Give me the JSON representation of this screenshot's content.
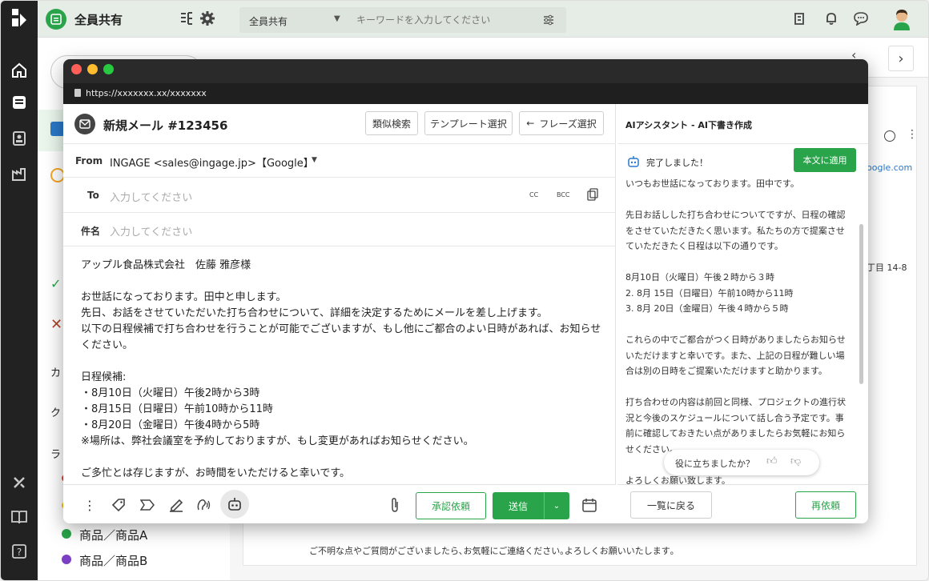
{
  "app": {
    "workspace": "全員共有"
  },
  "topbar": {
    "scope_select": "全員共有",
    "search_placeholder": "キーワードを入力してください"
  },
  "sidebar": {
    "items": [
      {
        "label": "カ"
      },
      {
        "label": "ク"
      },
      {
        "label": "ラ"
      }
    ],
    "categories": [
      {
        "label": "商品／商品A",
        "color": "#2aa44a"
      },
      {
        "label": "商品／商品B",
        "color": "#7b3fc4"
      }
    ]
  },
  "background": {
    "link_fragment": "oogle.com",
    "address_fragment": "丁目 14-8",
    "footer_text": "ご不明な点やご質問がございましたら､お気軽にご連絡ください｡よろしくお願いいたします｡"
  },
  "browser": {
    "url": "https://xxxxxxx.xx/xxxxxxx"
  },
  "compose": {
    "title": "新規メール #123456",
    "btn_similar": "類似検索",
    "btn_template": "テンプレート選択",
    "btn_phrase": "フレーズ選択",
    "from_label": "From",
    "from_value": "INGAGE <sales@ingage.jp>【Google】",
    "to_label": "To",
    "to_placeholder": "入力してください",
    "cc": "CC",
    "bcc": "BCC",
    "subject_label": "件名",
    "subject_placeholder": "入力してください",
    "body_lines": [
      "アップル食品株式会社　佐藤 雅彦様",
      "",
      "お世話になっております。田中と申します。",
      "先日、お話をさせていただいた打ち合わせについて、詳細を決定するためにメールを差し上げます。",
      "以下の日程候補で打ち合わせを行うことが可能でございますが、もし他にご都合のよい日時があれば、お知らせ",
      "ください。",
      "",
      "日程候補:",
      "・8月10日（火曜日）午後2時から3時",
      "・8月15日（日曜日）午前10時から11時",
      "・8月20日（金曜日）午後4時から5時",
      "※場所は、弊社会議室を予約しておりますが、もし変更があればお知らせください。",
      "",
      "ご多忙とは存じますが、お時間をいただけると幸いです。"
    ],
    "btn_approval": "承認依頼",
    "btn_send": "送信"
  },
  "ai": {
    "title": "AIアシスタント - AI下書き作成",
    "status": "完了しました！",
    "btn_apply": "本文に適用",
    "lines": [
      "いつもお世話になっております。田中です。",
      "",
      "先日お話しした打ち合わせについてですが、日程の確認",
      "をさせていただきたく思います。私たちの方で提案させ",
      "ていただきたく日程は以下の通りです。",
      "",
      "8月10日（火曜日）午後２時から３時",
      "2. 8月 15日（日曜日）午前10時から11時",
      "3. 8月 20日（金曜日）午後４時から５時",
      "",
      "これらの中でご都合がつく日時がありましたらお知らせ",
      "いただけますと幸いです。また、上記の日程が難しい場",
      "合は別の日時をご提案いただけますと助かります。",
      "",
      "打ち合わせの内容は前回と同様、プロジェクトの進行状",
      "況と今後のスケジュールについて話し合う予定です。事",
      "前に確認しておきたい点がありましたらお気軽にお知ら",
      "せください。",
      "",
      "よろしくお願い致します。"
    ],
    "feedback": "役に立ちましたか？",
    "btn_back": "一覧に戻る",
    "btn_retry": "再依頼"
  },
  "colors": {
    "accent": "#2aa44a",
    "rail": "#222222"
  }
}
